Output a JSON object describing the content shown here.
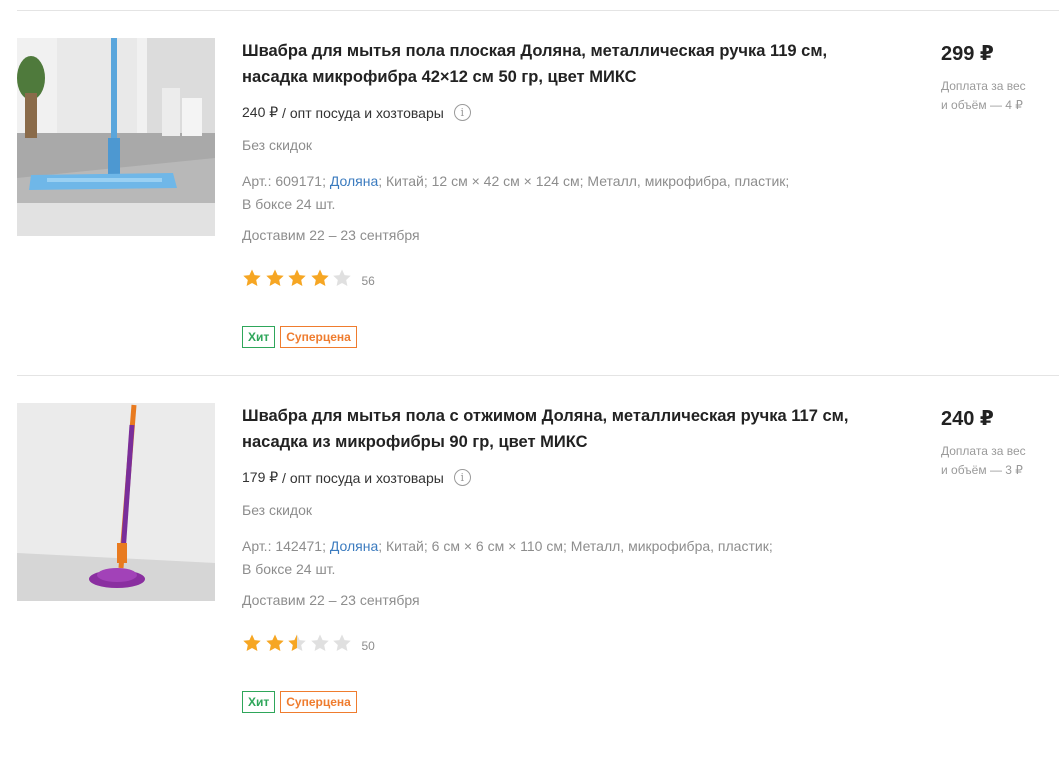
{
  "products": [
    {
      "title_line1": "Швабра для мытья пола плоская Доляна, металлическая ручка 119 см,",
      "title_line2": "насадка микрофибра 42×12 см 50 гр, цвет МИКС",
      "wholesale_price": "240 ₽",
      "wholesale_label": "/ опт посуда и хозтовары",
      "discount": "Без скидок",
      "art": "Арт.: 609171;",
      "brand": "Доляна",
      "country": "; Китай;",
      "dimensions": "12 см × 42 см × 124 см;",
      "materials": "Металл, микрофибра, пластик;",
      "box": "В боксе 24 шт.",
      "delivery": "Доставим 22 – 23 сентября",
      "rating": 4,
      "reviews": "56",
      "badge_hit": "Хит",
      "badge_super": "Суперцена",
      "price": "299 ₽",
      "surcharge_line1": "Доплата за вес",
      "surcharge_line2": "и объём — 4 ₽",
      "image": "flat-blue-mop"
    },
    {
      "title_line1": "Швабра для мытья пола с отжимом Доляна, металлическая ручка 117 см,",
      "title_line2": "насадка из микрофибры 90 гр, цвет МИКС",
      "wholesale_price": "179 ₽",
      "wholesale_label": "/ опт посуда и хозтовары",
      "discount": "Без скидок",
      "art": "Арт.: 142471;",
      "brand": "Доляна",
      "country": "; Китай;",
      "dimensions": "6 см × 6 см × 110 см;",
      "materials": "Металл, микрофибра, пластик;",
      "box": "В боксе 24 шт.",
      "delivery": "Доставим 22 – 23 сентября",
      "rating": 2.5,
      "reviews": "50",
      "badge_hit": "Хит",
      "badge_super": "Суперцена",
      "price": "240 ₽",
      "surcharge_line1": "Доплата за вес",
      "surcharge_line2": "и объём — 3 ₽",
      "image": "purple-twist-mop"
    }
  ],
  "colors": {
    "star_filled": "#f6a623",
    "star_empty": "#e0e0e0",
    "link": "#3b7bbf",
    "badge_hit": "#2ea65a",
    "badge_super": "#ef7c2e"
  }
}
